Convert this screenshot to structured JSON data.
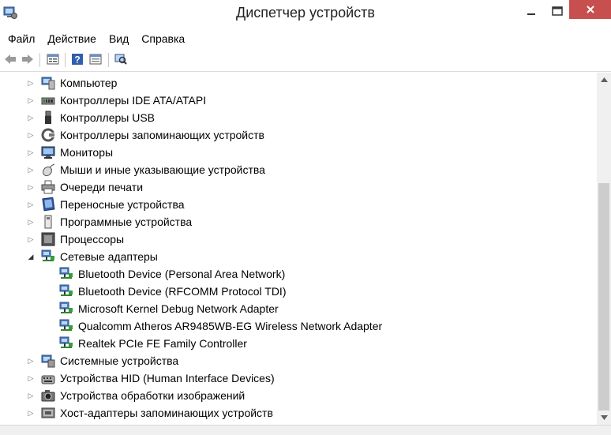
{
  "window": {
    "title": "Диспетчер устройств"
  },
  "menu": [
    "Файл",
    "Действие",
    "Вид",
    "Справка"
  ],
  "toolbar": {
    "icons": [
      "back-arrow-icon",
      "forward-arrow-icon",
      "properties-icon",
      "help-icon",
      "show-hidden-icon",
      "scan-hardware-icon"
    ]
  },
  "tree": {
    "categories_top": [
      {
        "label": "Компьютер",
        "icon": "computer-icon"
      },
      {
        "label": "Контроллеры IDE ATA/ATAPI",
        "icon": "ide-controller-icon"
      },
      {
        "label": "Контроллеры USB",
        "icon": "usb-icon"
      },
      {
        "label": "Контроллеры запоминающих устройств",
        "icon": "storage-controller-icon"
      },
      {
        "label": "Мониторы",
        "icon": "monitor-icon"
      },
      {
        "label": "Мыши и иные указывающие устройства",
        "icon": "mouse-icon"
      },
      {
        "label": "Очереди печати",
        "icon": "printer-icon"
      },
      {
        "label": "Переносные устройства",
        "icon": "portable-device-icon"
      },
      {
        "label": "Программные устройства",
        "icon": "software-device-icon"
      },
      {
        "label": "Процессоры",
        "icon": "processor-icon"
      }
    ],
    "expanded_category": {
      "label": "Сетевые адаптеры",
      "icon": "network-adapter-icon"
    },
    "network_adapters": [
      "Bluetooth Device (Personal Area Network)",
      "Bluetooth Device (RFCOMM Protocol TDI)",
      "Microsoft Kernel Debug Network Adapter",
      "Qualcomm Atheros AR9485WB-EG Wireless Network Adapter",
      "Realtek PCIe FE Family Controller"
    ],
    "categories_bottom": [
      {
        "label": "Системные устройства",
        "icon": "system-device-icon"
      },
      {
        "label": "Устройства HID (Human Interface Devices)",
        "icon": "hid-icon"
      },
      {
        "label": "Устройства обработки изображений",
        "icon": "imaging-device-icon"
      },
      {
        "label": "Хост-адаптеры запоминающих устройств",
        "icon": "storage-host-adapter-icon"
      }
    ]
  },
  "colors": {
    "close_button": "#c7504f",
    "accent_blue": "#1f5fbf"
  }
}
